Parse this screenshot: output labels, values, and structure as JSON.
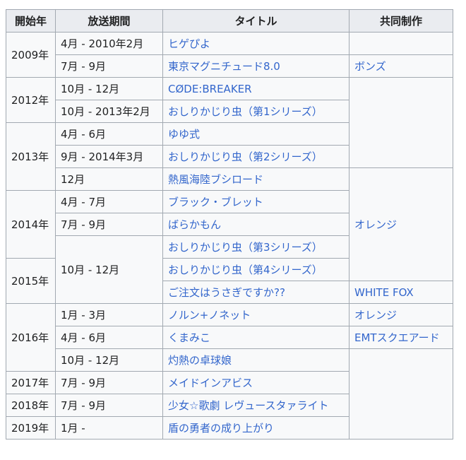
{
  "headers": [
    "開始年",
    "放送期間",
    "タイトル",
    "共同制作"
  ],
  "years": {
    "y2009": "2009年",
    "y2012": "2012年",
    "y2013": "2013年",
    "y2014": "2014年",
    "y2015": "2015年",
    "y2016": "2016年",
    "y2017": "2017年",
    "y2018": "2018年",
    "y2019": "2019年"
  },
  "periods": {
    "r1": "4月 - 2010年2月",
    "r2": "7月 - 9月",
    "r3": "10月 - 12月",
    "r4": "10月 - 2013年2月",
    "r5": "4月 - 6月",
    "r6": "9月 - 2014年3月",
    "r7": "12月",
    "r8": "4月 - 7月",
    "r9": "7月 - 9月",
    "r10": "10月 - 12月",
    "r13": "1月 - 3月",
    "r14": "4月 - 6月",
    "r15": "10月 - 12月",
    "r16": "7月 - 9月",
    "r17": "7月 - 9月",
    "r18": "1月 -"
  },
  "titles": [
    "ヒゲぴよ",
    "東京マグニチュード8.0",
    "CØDE:BREAKER",
    "おしりかじり虫（第1シリーズ）",
    "ゆゆ式",
    "おしりかじり虫（第2シリーズ）",
    "熱風海陸ブシロード",
    "ブラック・ブレット",
    "ばらかもん",
    "おしりかじり虫（第3シリーズ）",
    "おしりかじり虫（第4シリーズ）",
    "ご注文はうさぎですか??",
    "ノルン+ノネット",
    "くまみこ",
    "灼熱の卓球娘",
    "メイドインアビス",
    "少女☆歌劇 レヴュースタァライト",
    "盾の勇者の成り上がり"
  ],
  "coproductions": {
    "bones": "ボンズ",
    "orange1": "オレンジ",
    "whitefox": "WHITE FOX",
    "orange2": "オレンジ",
    "emt": "EMTスクエアード"
  }
}
